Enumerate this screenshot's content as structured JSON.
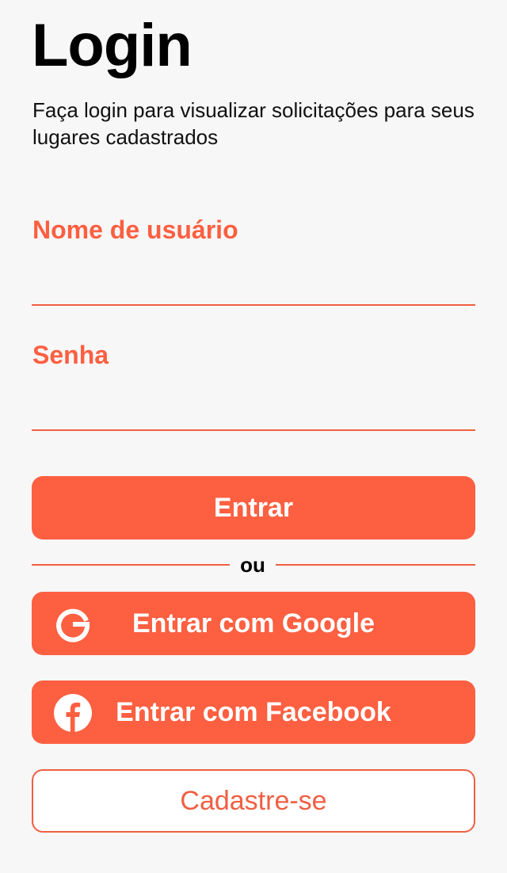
{
  "colors": {
    "accent": "#fd5f41",
    "background": "#f7f7f7",
    "line": "#f05f43"
  },
  "page": {
    "title": "Login",
    "subtitle": "Faça login para visualizar solicitações para seus lugares cadastrados"
  },
  "form": {
    "username_label": "Nome de usuário",
    "username_value": "",
    "password_label": "Senha",
    "password_value": ""
  },
  "actions": {
    "login_label": "Entrar",
    "separator": "ou",
    "google": {
      "label": "Entrar com Google",
      "icon": "google-icon"
    },
    "facebook": {
      "label": "Entrar com Facebook",
      "icon": "facebook-icon"
    },
    "signup_label": "Cadastre-se"
  }
}
